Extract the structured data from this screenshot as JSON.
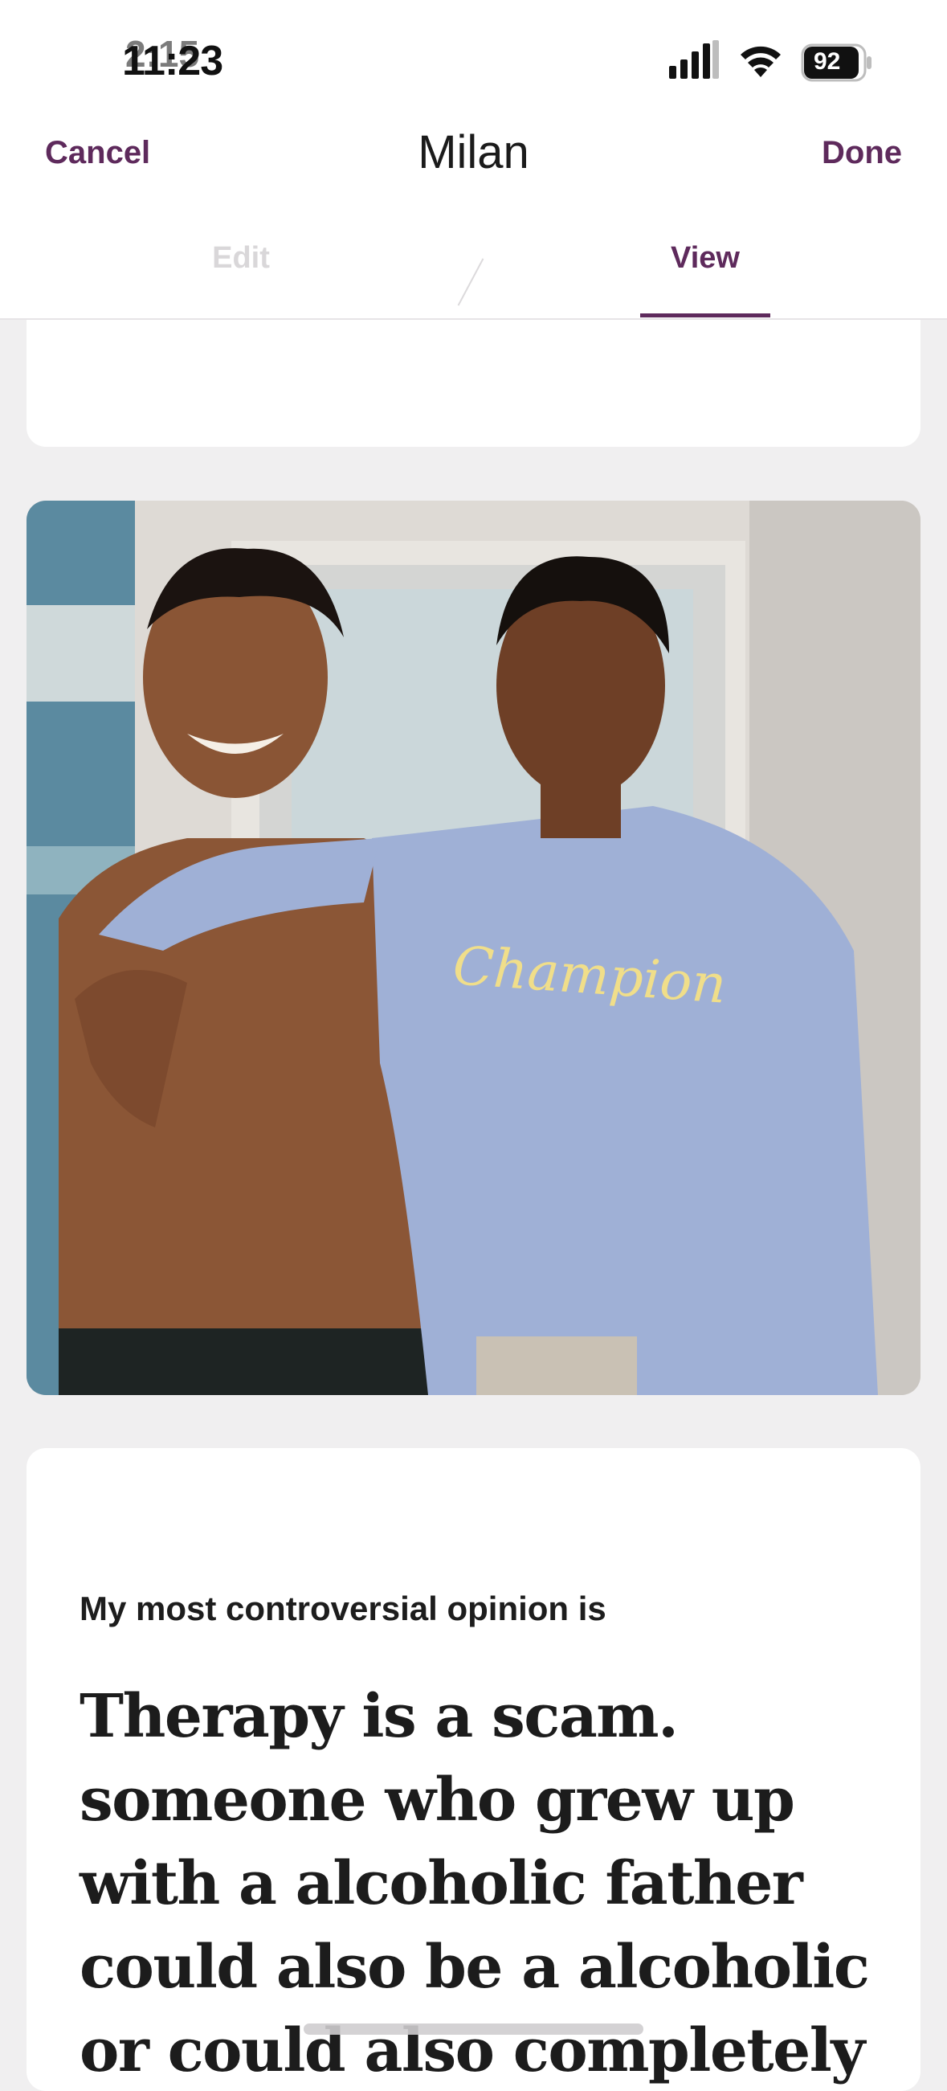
{
  "status_bar": {
    "time": "11:23",
    "time_overlay": "2:15",
    "battery": "92"
  },
  "nav": {
    "cancel_label": "Cancel",
    "title": "Milan",
    "done_label": "Done"
  },
  "tabs": {
    "edit_label": "Edit",
    "view_label": "View",
    "active": "View"
  },
  "photo": {
    "sweatshirt_text": "Champion"
  },
  "prompt": {
    "question": "My most controversial opinion is",
    "answer": "Therapy is a scam. someone who grew up with a alcoholic father could also be a alcoholic or could also completely dismiss it"
  },
  "colors": {
    "accent": "#5e2a5c",
    "background": "#f0eff0",
    "card": "#ffffff"
  }
}
